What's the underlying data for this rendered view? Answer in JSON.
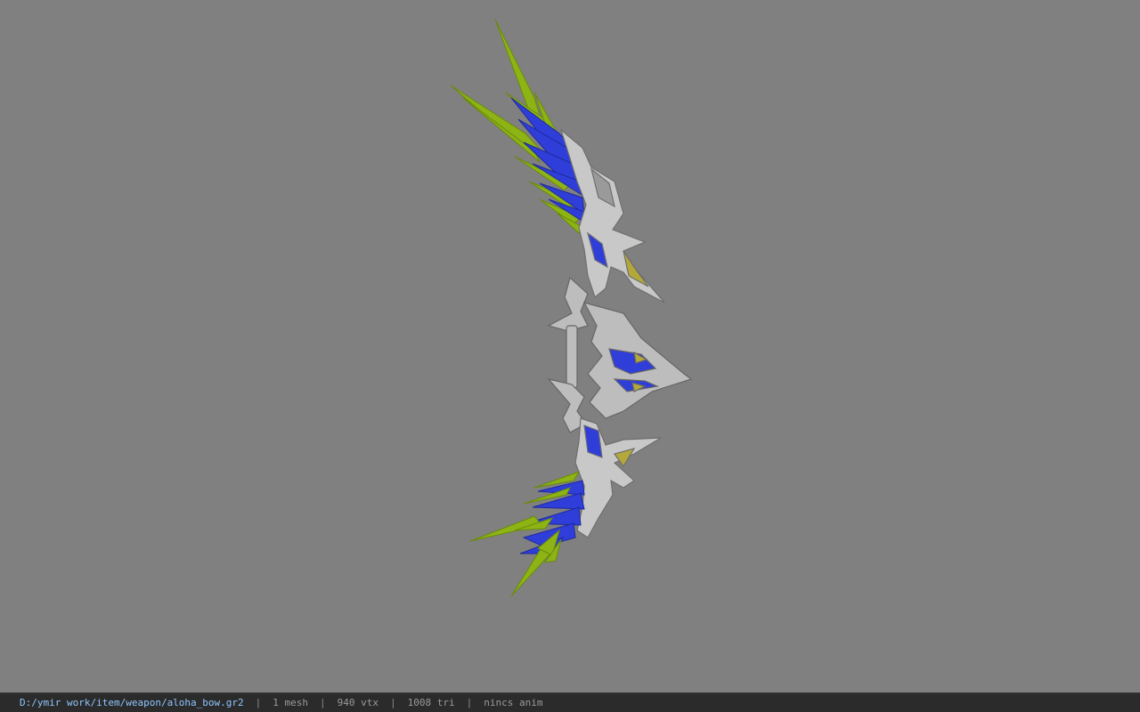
{
  "status_bar": {
    "file_path": "D:/ymir work/item/weapon/aloha_bow.gr2",
    "separator": "|",
    "mesh_count": "1 mesh",
    "vertex_count": "940 vtx",
    "triangle_count": "1008 tri",
    "animation": "nincs anim"
  },
  "colors": {
    "background": "#808080",
    "status_bar_bg": "#2b2b2b",
    "path_text": "#8ec6ff",
    "status_text": "#9a9a9a",
    "feather_green": "#8db414",
    "feather_blue": "#2f3ed8",
    "metal": "#c8c8c8"
  }
}
